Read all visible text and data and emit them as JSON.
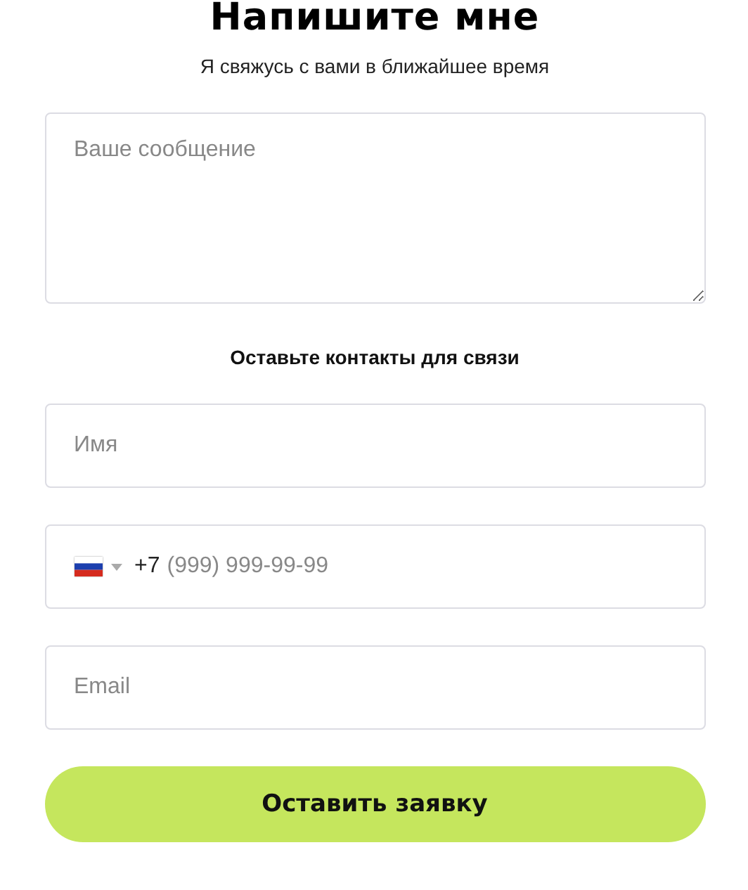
{
  "title": "Напишите мне",
  "subtitle": "Я свяжусь с вами в ближайшее время",
  "message": {
    "placeholder": "Ваше сообщение"
  },
  "contacts_heading": "Оставьте контакты для связи",
  "name": {
    "placeholder": "Имя"
  },
  "phone": {
    "code": "+7",
    "placeholder": "(999) 999-99-99"
  },
  "email": {
    "placeholder": "Email"
  },
  "submit": "Оставить заявку"
}
